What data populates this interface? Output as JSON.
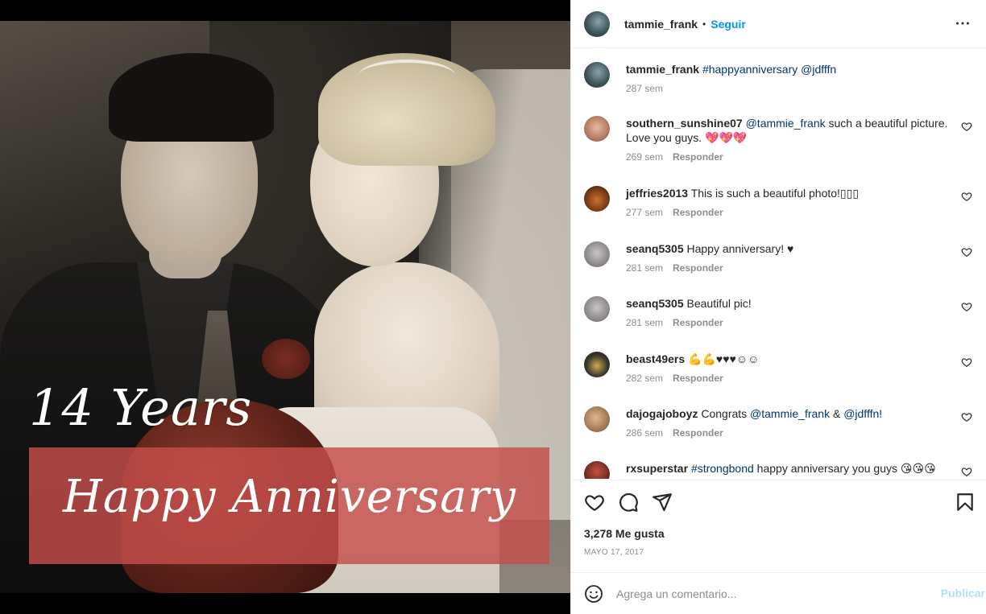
{
  "post": {
    "overlay_years": "14 Years",
    "overlay_title": "Happy Anniversary"
  },
  "header": {
    "username": "tammie_frank",
    "separator": "•",
    "follow_label": "Seguir",
    "more_label": "•••"
  },
  "caption": {
    "username": "tammie_frank",
    "hashtag": "#happyanniversary",
    "mention": "@jdfffn",
    "age": "287 sem"
  },
  "comments": [
    {
      "username": "southern_sunshine07",
      "mention": "@tammie_frank",
      "text": " such a beautiful picture. Love you guys. 💖💖💖",
      "age": "269 sem",
      "reply": "Responder"
    },
    {
      "username": "jeffries2013",
      "text": "This is such a beautiful photo!▯▯▯",
      "age": "277 sem",
      "reply": "Responder"
    },
    {
      "username": "seanq5305",
      "text": "Happy anniversary! ♥",
      "age": "281 sem",
      "reply": "Responder"
    },
    {
      "username": "seanq5305",
      "text": "Beautiful pic!",
      "age": "281 sem",
      "reply": "Responder"
    },
    {
      "username": "beast49ers",
      "text": "💪💪♥♥♥☺☺",
      "age": "282 sem",
      "reply": "Responder"
    },
    {
      "username": "dajogajoboyz",
      "text_before": "Congrats ",
      "mention1": "@tammie_frank",
      "amp": " & ",
      "mention2": "@jdfffn",
      "after": "!",
      "age": "286 sem",
      "reply": "Responder"
    },
    {
      "username": "rxsuperstar",
      "hashtag": "#strongbond",
      "text": " happy anniversary you guys 😘😘😘"
    }
  ],
  "stats": {
    "likes": "3,278 Me gusta",
    "date": "MAYO 17, 2017"
  },
  "composer": {
    "placeholder": "Agrega un comentario...",
    "publish_label": "Publicar"
  },
  "icons": {
    "like": "heart-icon",
    "comment": "comment-icon",
    "share": "paper-plane-icon",
    "save": "bookmark-icon",
    "emoji": "emoji-icon",
    "more": "more-options-icon"
  },
  "colors": {
    "link_blue": "#0095f6",
    "mention_blue": "#00376b",
    "banner_red": "#c44e4a",
    "publish_disabled": "#b2dffc",
    "muted_text": "#8e8e8e"
  }
}
